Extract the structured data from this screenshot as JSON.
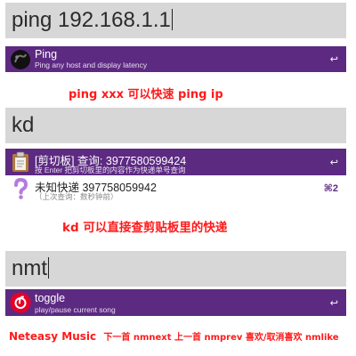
{
  "section1": {
    "query": "ping 192.168.1.1",
    "result": {
      "title": "Ping",
      "subtitle": "Ping any host and display latency",
      "shortcut": "↩",
      "icon": "ping-workflow-icon"
    },
    "caption": "ping xxx 可以快速 ping ip"
  },
  "section2": {
    "query": "kd",
    "results": [
      {
        "title": "[剪切板] 查询: 3977580599424",
        "subtitle": "按 Enter 把剪切板里的内容作为快递单号查询",
        "shortcut": "↩",
        "icon": "clipboard-icon"
      },
      {
        "title": "未知快递 397758059942",
        "subtitle": "（上次查询：数秒钟前）",
        "shortcut": "⌘2",
        "icon": "question-mark-icon"
      }
    ],
    "caption": "kd 可以直接查剪贴板里的快递"
  },
  "section3": {
    "query": "nmt",
    "result": {
      "title": "toggle",
      "subtitle": "play/pause current song",
      "shortcut": "↩",
      "icon": "netease-music-icon"
    },
    "caption_brand": "Neteasy Music",
    "caption_rest": "下一首 nmnext 上一首 nmprev 喜欢/取消喜欢 nmlike"
  },
  "colors": {
    "selected_bg": "#5d2a82",
    "searchbar_bg": "#d7d7d7",
    "caption": "#ff1a1a"
  }
}
